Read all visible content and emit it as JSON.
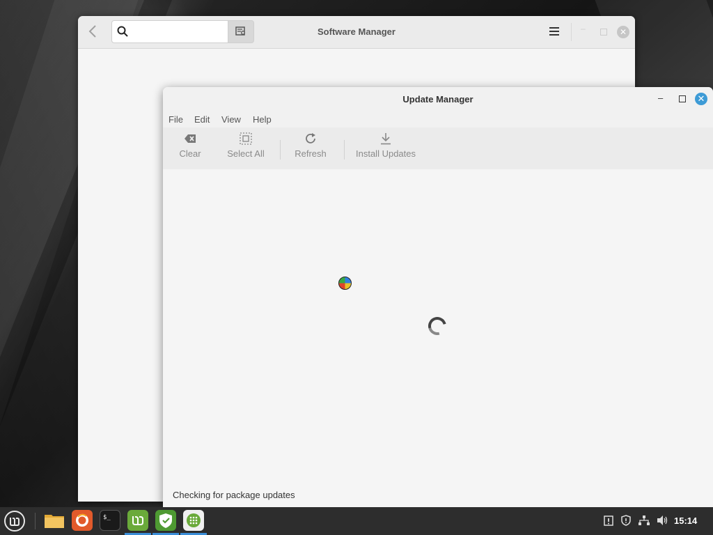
{
  "software_manager": {
    "title": "Software Manager",
    "search_placeholder": ""
  },
  "update_manager": {
    "title": "Update Manager",
    "menu": [
      "File",
      "Edit",
      "View",
      "Help"
    ],
    "toolbar": {
      "clear": "Clear",
      "select_all": "Select All",
      "refresh": "Refresh",
      "install_updates": "Install Updates"
    },
    "status": "Checking for package updates"
  },
  "taskbar": {
    "apps": [
      "mint-menu-icon",
      "folder-icon",
      "firefox-icon",
      "terminal-icon",
      "mintinstall-icon",
      "mintupdate-shield-icon",
      "package-icon"
    ],
    "clock": "15:14"
  },
  "colors": {
    "accent": "#3d9bd6",
    "taskbar": "#2d2d2d",
    "mint_green": "#7cb342"
  }
}
